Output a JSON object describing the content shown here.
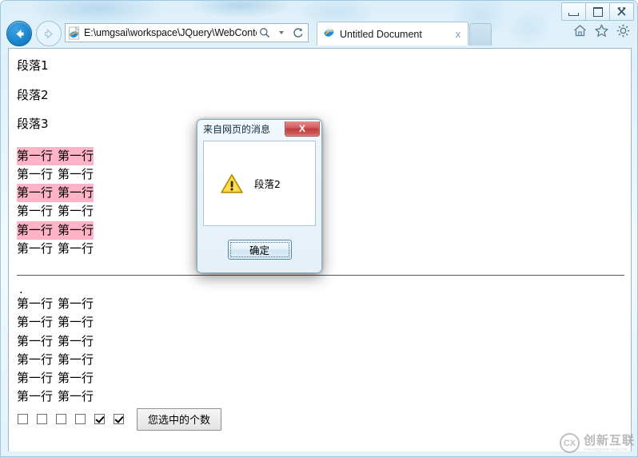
{
  "window": {
    "caption": {
      "minimize_label": "Minimize",
      "maximize_label": "Maximize",
      "close_label": "Close"
    }
  },
  "browser": {
    "back_label": "Back",
    "forward_label": "Forward",
    "address": {
      "value": "E:\\umgsai\\workspace\\JQuery\\WebConte",
      "search_label": "Search",
      "refresh_label": "Refresh"
    },
    "tab": {
      "title": "Untitled Document",
      "close_label": "x"
    },
    "new_tab_label": "",
    "commands": {
      "home_label": "Home",
      "favorites_label": "Favorites",
      "tools_label": "Tools"
    }
  },
  "page": {
    "paragraphs": [
      "段落1",
      "段落2",
      "段落3"
    ],
    "table_one": {
      "rows": [
        {
          "cells": [
            "第一行",
            "第一行"
          ],
          "highlight": true
        },
        {
          "cells": [
            "第一行",
            "第一行"
          ],
          "highlight": false
        },
        {
          "cells": [
            "第一行",
            "第一行"
          ],
          "highlight": true
        },
        {
          "cells": [
            "第一行",
            "第一行"
          ],
          "highlight": false
        },
        {
          "cells": [
            "第一行",
            "第一行"
          ],
          "highlight": true
        },
        {
          "cells": [
            "第一行",
            "第一行"
          ],
          "highlight": false
        }
      ],
      "highlight_color": "#FFB3C6"
    },
    "dot_mark": ".",
    "table_two": {
      "rows": [
        {
          "cells": [
            "第一行",
            "第一行"
          ]
        },
        {
          "cells": [
            "第一行",
            "第一行"
          ]
        },
        {
          "cells": [
            "第一行",
            "第一行"
          ]
        },
        {
          "cells": [
            "第一行",
            "第一行"
          ]
        },
        {
          "cells": [
            "第一行",
            "第一行"
          ]
        },
        {
          "cells": [
            "第一行",
            "第一行"
          ]
        }
      ]
    },
    "checkboxes": [
      {
        "checked": false
      },
      {
        "checked": false
      },
      {
        "checked": false
      },
      {
        "checked": false
      },
      {
        "checked": false
      },
      {
        "checked": true
      }
    ],
    "count_button_label": "您选中的个数"
  },
  "dialog": {
    "title": "来自网页的消息",
    "close_label": "X",
    "message": "段落2",
    "icon": "warning-icon",
    "ok_label": "确定"
  },
  "watermark": {
    "badge": "CX",
    "name_cn": "创新互联",
    "name_en": "CHUANGXIN HULIAN"
  }
}
